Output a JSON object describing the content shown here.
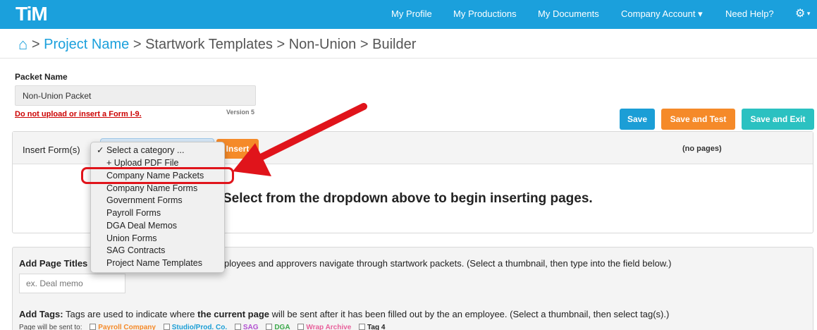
{
  "app": {
    "logo": "TiM"
  },
  "nav": {
    "items": [
      {
        "label": "My Profile"
      },
      {
        "label": "My Productions"
      },
      {
        "label": "My Documents"
      },
      {
        "label": "Company Account ▾"
      },
      {
        "label": "Need Help?"
      }
    ],
    "settings_icon": "gear-icon"
  },
  "breadcrumb": {
    "home_icon": "home-icon",
    "sep": ">",
    "items": [
      "Project Name",
      "Startwork Templates",
      "Non-Union",
      "Builder"
    ]
  },
  "packet": {
    "label": "Packet Name",
    "value": "Non-Union Packet",
    "warning": "Do not upload or insert a Form I-9.",
    "version": "Version 5"
  },
  "actions": {
    "save": "Save",
    "save_test": "Save and Test",
    "save_exit": "Save and Exit"
  },
  "insert": {
    "label": "Insert Form(s)",
    "button_label": "Insert",
    "no_pages": "(no pages)",
    "empty_message": "Select from the dropdown above to begin inserting pages."
  },
  "dropdown": {
    "options": [
      "✓ Select a category ...",
      "+ Upload PDF File",
      "Company Name Packets",
      "Company Name Forms",
      "Government Forms",
      "Payroll Forms",
      "DGA Deal Memos",
      "Union Forms",
      "SAG Contracts",
      "Project Name Templates"
    ]
  },
  "titles": {
    "heading": "Add Page Titles",
    "text": "employees and approvers navigate through startwork packets. (Select a thumbnail, then type into the field below.)",
    "placeholder": "ex. Deal memo"
  },
  "tags": {
    "heading": "Add Tags:",
    "text1": "Tags are used to indicate where",
    "emph": "the current page",
    "text2": "will be sent after it has been filled out by the an employee. (Select a thumbnail, then select tag(s).)",
    "sent_label": "Page will be sent to:",
    "items": [
      "Payroll Company",
      "Studio/Prod. Co.",
      "SAG",
      "DGA",
      "Wrap Archive",
      "Tag 4"
    ]
  },
  "colors": {
    "brand": "#1ba0dc",
    "orange": "#f58a29",
    "teal": "#2bc1c1",
    "alert": "#e0141b"
  }
}
